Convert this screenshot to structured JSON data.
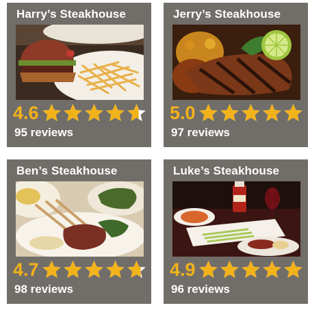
{
  "colors": {
    "card_background": "#716d69",
    "rating_color": "#f2b21a",
    "star_color": "#f2b21a",
    "star_empty_color": "#ffffff",
    "text_color": "#ffffff"
  },
  "restaurants": [
    {
      "name": "Harry’s Steakhouse",
      "rating": "4.6",
      "stars_value": 4.6,
      "reviews": "95 reviews",
      "photo": "burger-and-fries-photo"
    },
    {
      "name": "Jerry’s Steakhouse",
      "rating": "5.0",
      "stars_value": 5.0,
      "reviews": "97 reviews",
      "photo": "grilled-steak-with-lime-photo"
    },
    {
      "name": "Ben’s Steakhouse",
      "rating": "4.7",
      "stars_value": 4.7,
      "reviews": "98 reviews",
      "photo": "lamb-chops-plate-photo"
    },
    {
      "name": "Luke’s Steakhouse",
      "rating": "4.9",
      "stars_value": 4.9,
      "reviews": "96 reviews",
      "photo": "table-with-ketchup-and-wine-photo"
    }
  ]
}
